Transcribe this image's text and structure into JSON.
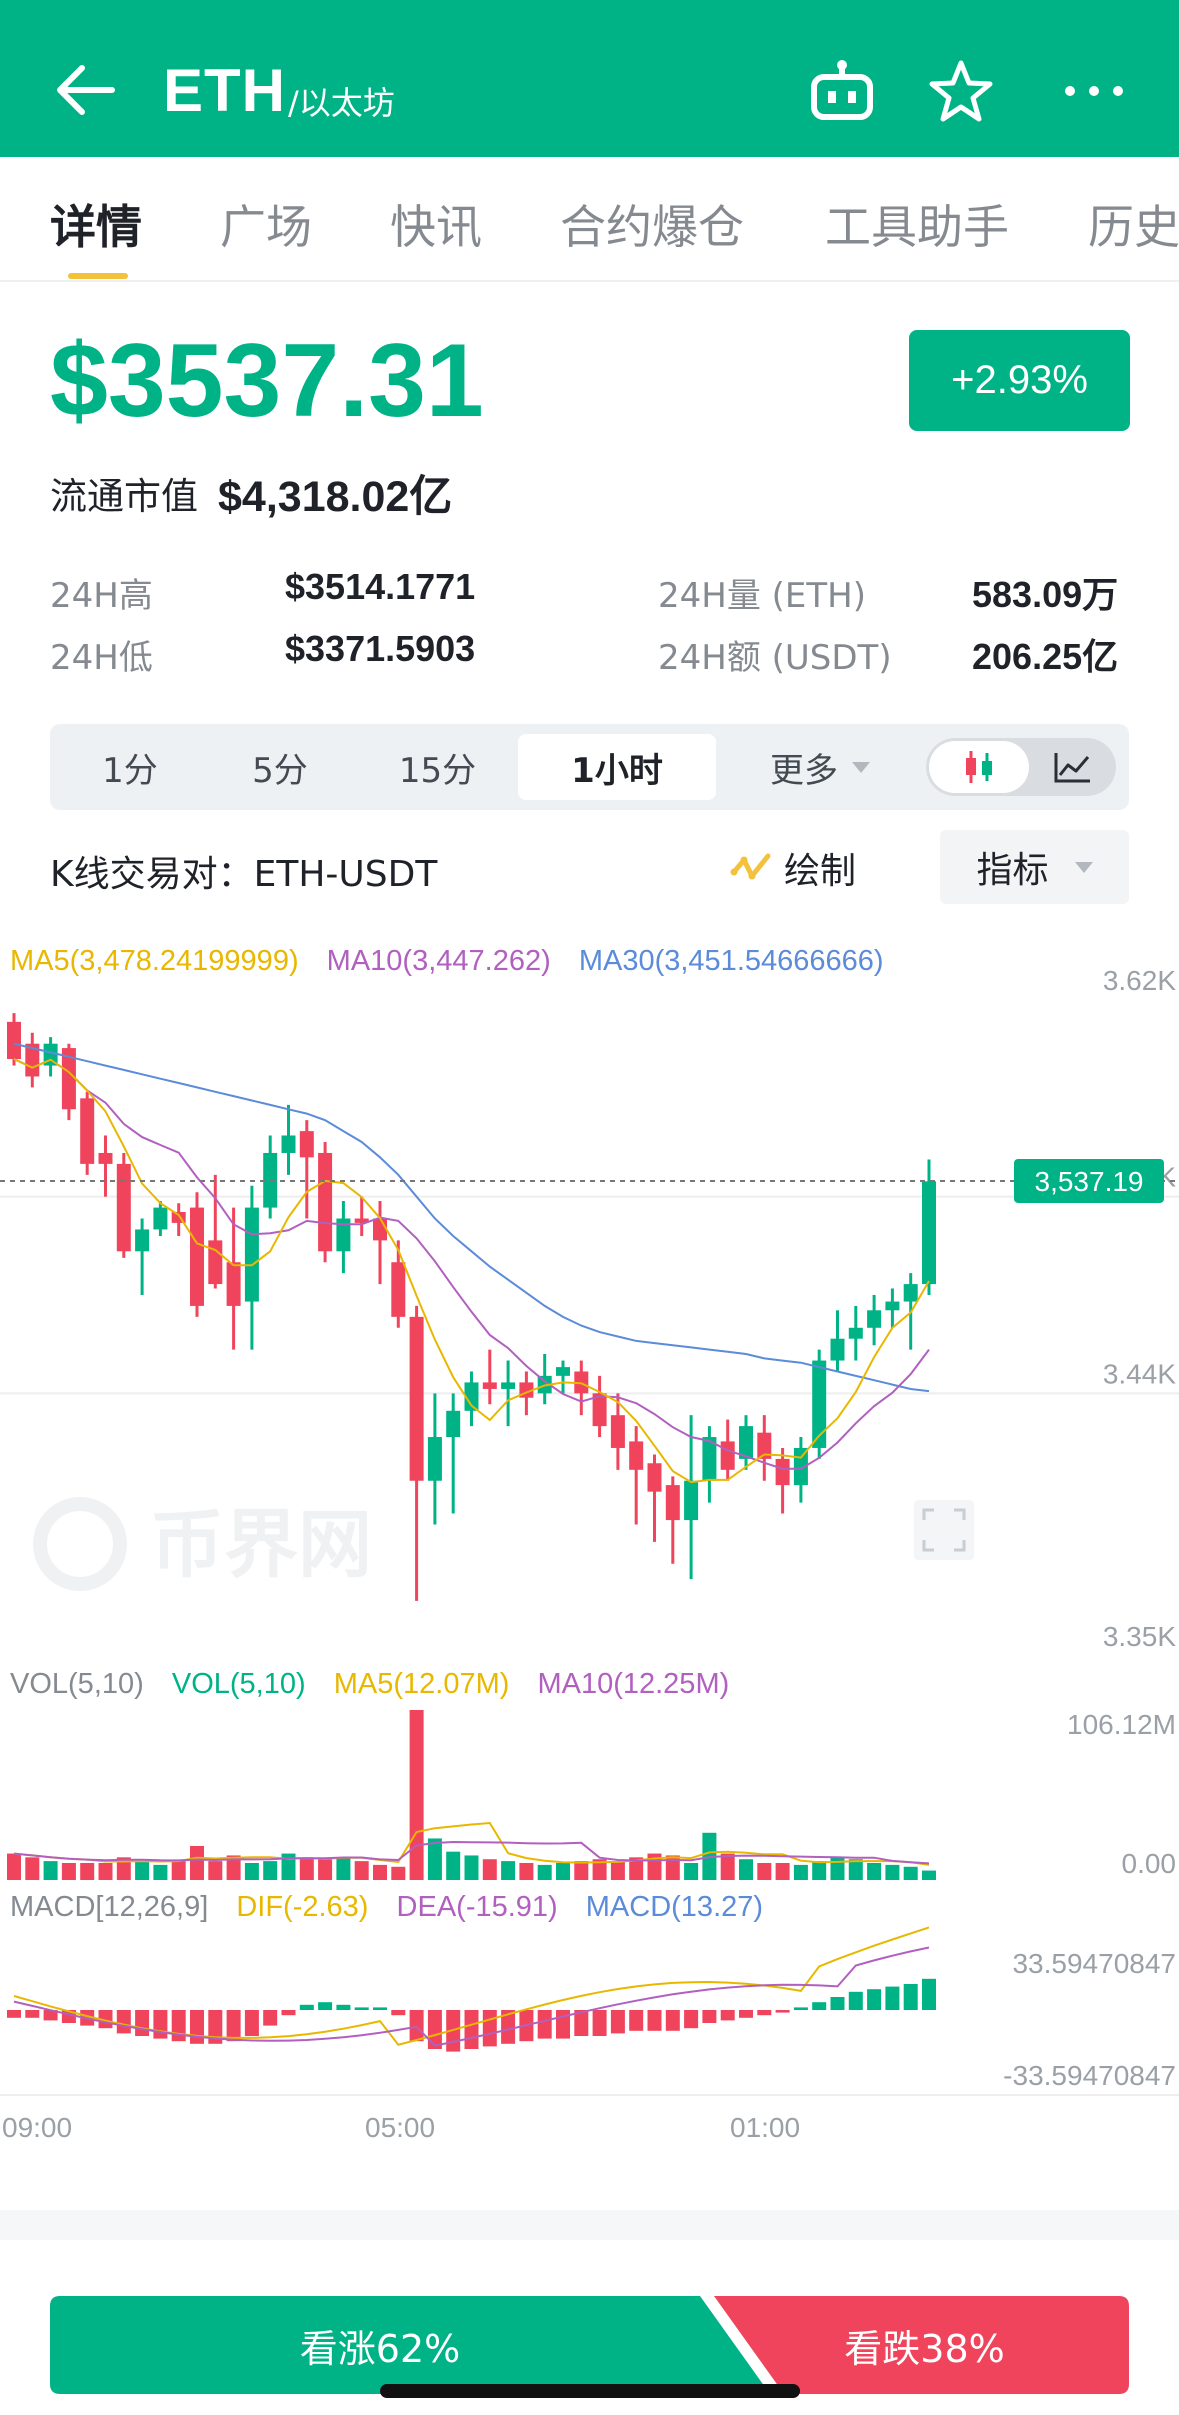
{
  "header": {
    "title": "ETH",
    "subtitle": "/以太坊",
    "icons": [
      "back-arrow-icon",
      "robot-icon",
      "star-icon",
      "more-icon"
    ]
  },
  "tabs": [
    "详情",
    "广场",
    "快讯",
    "合约爆仓",
    "工具助手",
    "历史"
  ],
  "active_tab": "详情",
  "price": "$3537.31",
  "change": "+2.93%",
  "market_cap": {
    "label": "流通市值",
    "value": "$4,318.02亿"
  },
  "stats": [
    {
      "label": "24H高",
      "value": "$3514.1771"
    },
    {
      "label": "24H量 (ETH)",
      "value": "583.09万"
    },
    {
      "label": "24H低",
      "value": "$3371.5903"
    },
    {
      "label": "24H额 (USDT)",
      "value": "206.25亿"
    }
  ],
  "periods": [
    "1分",
    "5分",
    "15分",
    "1小时",
    "更多"
  ],
  "active_period": "1小时",
  "pair_label": "K线交易对：ETH-USDT",
  "draw_label": "绘制",
  "indicator_label": "指标",
  "colors": {
    "brand": "#00b386",
    "up": "#00b386",
    "down": "#f0445c",
    "ma5": "#e8b800",
    "ma10": "#b160c0",
    "ma30": "#5b8bd9",
    "highlight": "#f3c13a"
  },
  "legends": {
    "ma": [
      "MA5(3,478.24199999)",
      "MA10(3,447.262)",
      "MA30(3,451.54666666)"
    ],
    "vol": [
      "VOL(5,10)",
      "VOL(5,10)",
      "MA5(12.07M)",
      "MA10(12.25M)"
    ],
    "macd": [
      "MACD[12,26,9]",
      "DIF(-2.63)",
      "DEA(-15.91)",
      "MACD(13.27)"
    ]
  },
  "watermark": "币界网",
  "chart_data": {
    "type": "candlestick",
    "price_axis": {
      "ticks": [
        "3.62K",
        "3.53K",
        "3.44K",
        "3.35K"
      ],
      "values": [
        3620,
        3530,
        3440,
        3350
      ]
    },
    "current_price_label": "3,537.19",
    "current_price": 3537.19,
    "volume_axis": [
      "106.12M",
      "0.00"
    ],
    "macd_axis": [
      "33.59470847",
      "-33.59470847"
    ],
    "time_labels": [
      "09:00",
      "05:00",
      "01:00"
    ],
    "candles": [
      {
        "o": 3610,
        "c": 3593,
        "h": 3614,
        "l": 3590
      },
      {
        "o": 3600,
        "c": 3585,
        "h": 3605,
        "l": 3580
      },
      {
        "o": 3590,
        "c": 3600,
        "h": 3603,
        "l": 3585
      },
      {
        "o": 3598,
        "c": 3570,
        "h": 3600,
        "l": 3565
      },
      {
        "o": 3575,
        "c": 3545,
        "h": 3578,
        "l": 3540
      },
      {
        "o": 3550,
        "c": 3545,
        "h": 3558,
        "l": 3530
      },
      {
        "o": 3545,
        "c": 3505,
        "h": 3550,
        "l": 3502
      },
      {
        "o": 3505,
        "c": 3515,
        "h": 3520,
        "l": 3485
      },
      {
        "o": 3515,
        "c": 3525,
        "h": 3528,
        "l": 3512
      },
      {
        "o": 3523,
        "c": 3518,
        "h": 3527,
        "l": 3512
      },
      {
        "o": 3525,
        "c": 3480,
        "h": 3532,
        "l": 3475
      },
      {
        "o": 3510,
        "c": 3490,
        "h": 3540,
        "l": 3488
      },
      {
        "o": 3500,
        "c": 3480,
        "h": 3525,
        "l": 3460
      },
      {
        "o": 3482,
        "c": 3525,
        "h": 3535,
        "l": 3460
      },
      {
        "o": 3525,
        "c": 3550,
        "h": 3558,
        "l": 3520
      },
      {
        "o": 3550,
        "c": 3558,
        "h": 3572,
        "l": 3540
      },
      {
        "o": 3560,
        "c": 3548,
        "h": 3565,
        "l": 3520
      },
      {
        "o": 3550,
        "c": 3505,
        "h": 3555,
        "l": 3500
      },
      {
        "o": 3505,
        "c": 3520,
        "h": 3528,
        "l": 3495
      },
      {
        "o": 3520,
        "c": 3518,
        "h": 3530,
        "l": 3512
      },
      {
        "o": 3520,
        "c": 3510,
        "h": 3528,
        "l": 3490
      },
      {
        "o": 3500,
        "c": 3475,
        "h": 3510,
        "l": 3470
      },
      {
        "o": 3475,
        "c": 3400,
        "h": 3480,
        "l": 3345
      },
      {
        "o": 3400,
        "c": 3420,
        "h": 3440,
        "l": 3380
      },
      {
        "o": 3420,
        "c": 3432,
        "h": 3440,
        "l": 3385
      },
      {
        "o": 3432,
        "c": 3445,
        "h": 3450,
        "l": 3425
      },
      {
        "o": 3445,
        "c": 3442,
        "h": 3460,
        "l": 3435
      },
      {
        "o": 3442,
        "c": 3445,
        "h": 3455,
        "l": 3425
      },
      {
        "o": 3445,
        "c": 3438,
        "h": 3450,
        "l": 3430
      },
      {
        "o": 3440,
        "c": 3448,
        "h": 3458,
        "l": 3435
      },
      {
        "o": 3448,
        "c": 3452,
        "h": 3455,
        "l": 3440
      },
      {
        "o": 3450,
        "c": 3440,
        "h": 3455,
        "l": 3430
      },
      {
        "o": 3440,
        "c": 3425,
        "h": 3448,
        "l": 3420
      },
      {
        "o": 3430,
        "c": 3415,
        "h": 3440,
        "l": 3405
      },
      {
        "o": 3418,
        "c": 3405,
        "h": 3425,
        "l": 3380
      },
      {
        "o": 3408,
        "c": 3395,
        "h": 3412,
        "l": 3372
      },
      {
        "o": 3398,
        "c": 3382,
        "h": 3402,
        "l": 3362
      },
      {
        "o": 3382,
        "c": 3400,
        "h": 3430,
        "l": 3355
      },
      {
        "o": 3400,
        "c": 3420,
        "h": 3425,
        "l": 3390
      },
      {
        "o": 3418,
        "c": 3405,
        "h": 3428,
        "l": 3400
      },
      {
        "o": 3410,
        "c": 3425,
        "h": 3430,
        "l": 3405
      },
      {
        "o": 3422,
        "c": 3410,
        "h": 3430,
        "l": 3400
      },
      {
        "o": 3410,
        "c": 3398,
        "h": 3415,
        "l": 3385
      },
      {
        "o": 3398,
        "c": 3415,
        "h": 3420,
        "l": 3390
      },
      {
        "o": 3415,
        "c": 3455,
        "h": 3460,
        "l": 3410
      },
      {
        "o": 3455,
        "c": 3465,
        "h": 3478,
        "l": 3450
      },
      {
        "o": 3465,
        "c": 3470,
        "h": 3480,
        "l": 3455
      },
      {
        "o": 3470,
        "c": 3478,
        "h": 3485,
        "l": 3462
      },
      {
        "o": 3478,
        "c": 3482,
        "h": 3488,
        "l": 3470
      },
      {
        "o": 3482,
        "c": 3490,
        "h": 3495,
        "l": 3460
      },
      {
        "o": 3490,
        "c": 3537,
        "h": 3547,
        "l": 3485
      }
    ],
    "volume": [
      14,
      12,
      10,
      9,
      9,
      9,
      12,
      11,
      8,
      10,
      18,
      10,
      13,
      9,
      10,
      14,
      12,
      11,
      12,
      10,
      8,
      7,
      90,
      22,
      15,
      13,
      11,
      10,
      9,
      8,
      9,
      10,
      11,
      10,
      12,
      14,
      13,
      9,
      25,
      14,
      11,
      9,
      9,
      8,
      10,
      12,
      11,
      9,
      8,
      7,
      5
    ],
    "macd_hist": [
      -3,
      -3,
      -4,
      -5,
      -6,
      -7,
      -9,
      -10,
      -11,
      -12,
      -13,
      -13,
      -12,
      -10,
      -6,
      -2,
      2,
      3,
      2,
      1,
      1,
      -2,
      -12,
      -15,
      -16,
      -15,
      -14,
      -13,
      -12,
      -11,
      -11,
      -10,
      -10,
      -9,
      -8,
      -8,
      -8,
      -7,
      -5,
      -4,
      -3,
      -2,
      -1,
      1,
      3,
      5,
      7,
      8,
      9,
      10,
      12
    ]
  }
}
